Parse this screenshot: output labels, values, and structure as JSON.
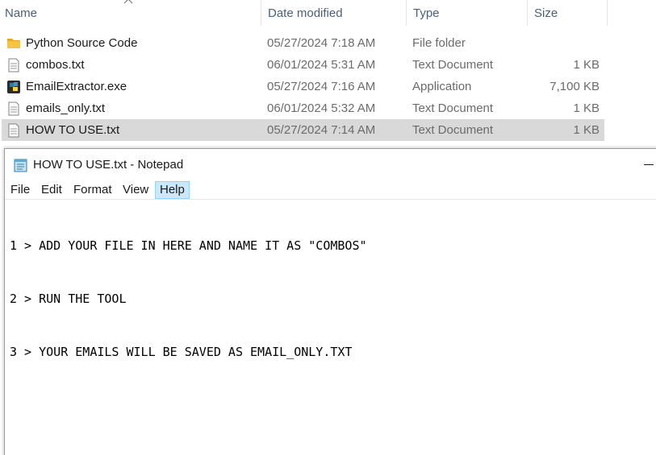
{
  "explorer": {
    "columns": {
      "name": "Name",
      "date_modified": "Date modified",
      "type": "Type",
      "size": "Size"
    },
    "files": [
      {
        "name": "Python Source Code",
        "date": "05/27/2024 7:18 AM",
        "type": "File folder",
        "size": "",
        "icon": "folder-icon",
        "selected": false
      },
      {
        "name": "combos.txt",
        "date": "06/01/2024 5:31 AM",
        "type": "Text Document",
        "size": "1 KB",
        "icon": "text-file-icon",
        "selected": false
      },
      {
        "name": "EmailExtractor.exe",
        "date": "05/27/2024 7:16 AM",
        "type": "Application",
        "size": "7,100 KB",
        "icon": "python-app-icon",
        "selected": false
      },
      {
        "name": "emails_only.txt",
        "date": "06/01/2024 5:32 AM",
        "type": "Text Document",
        "size": "1 KB",
        "icon": "text-file-icon",
        "selected": false
      },
      {
        "name": "HOW TO USE.txt",
        "date": "05/27/2024 7:14 AM",
        "type": "Text Document",
        "size": "1 KB",
        "icon": "text-file-icon",
        "selected": true
      }
    ]
  },
  "notepad": {
    "title": "HOW TO USE.txt - Notepad",
    "menu": [
      "File",
      "Edit",
      "Format",
      "View",
      "Help"
    ],
    "active_menu": "Help",
    "lines": [
      "1 > ADD YOUR FILE IN HERE AND NAME IT AS \"COMBOS\"",
      "2 > RUN THE TOOL",
      "3 > YOUR EMAILS WILL BE SAVED AS EMAIL_ONLY.TXT"
    ]
  },
  "colors": {
    "selection": "#d9d9d9",
    "header_text": "#4c607a",
    "menu_highlight": "#cce8ff",
    "folder": "#f6c444"
  }
}
